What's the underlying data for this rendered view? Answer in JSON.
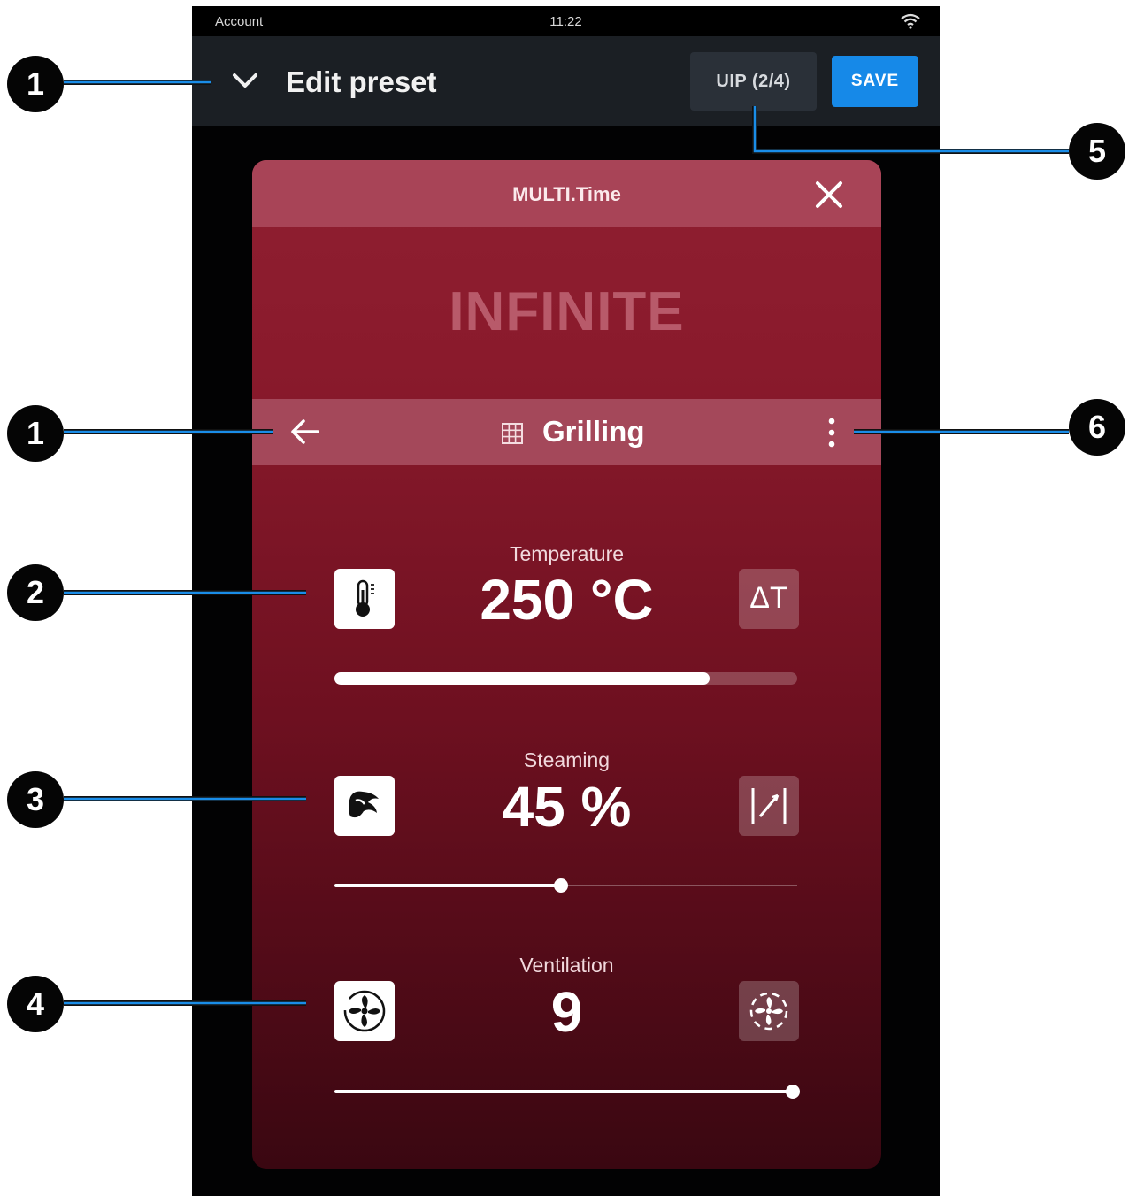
{
  "status_bar": {
    "account": "Account",
    "time": "11:22",
    "wifi_icon": "wifi-icon"
  },
  "top_bar": {
    "collapse_icon": "chevron-down-icon",
    "title": "Edit preset",
    "uip_button": "UIP (2/4)",
    "save_button": "SAVE"
  },
  "card": {
    "header_title": "MULTI.Time",
    "close_icon": "close-icon",
    "duration": "INFINITE",
    "mode_bar": {
      "back_icon": "arrow-left-icon",
      "mode_icon": "grid-icon",
      "mode_name": "Grilling",
      "menu_icon": "more-vertical-icon"
    },
    "parameters": [
      {
        "label": "Temperature",
        "value": "250 °C",
        "left_icon": "thermometer-icon",
        "right_icon": "delta-t-icon",
        "right_icon_text": "ΔT",
        "slider_fraction": 0.81
      },
      {
        "label": "Steaming",
        "value": "45 %",
        "left_icon": "steam-icon",
        "right_icon": "valve-icon",
        "slider_fraction": 0.49
      },
      {
        "label": "Ventilation",
        "value": "9",
        "left_icon": "fan-icon",
        "right_icon": "fan-pulse-icon",
        "slider_fraction": 0.99
      }
    ]
  },
  "callouts": [
    "1",
    "1",
    "2",
    "3",
    "4",
    "5",
    "6"
  ],
  "colors": {
    "save_blue": "#1689e8",
    "callout_line": "#1a8de8",
    "card_red": "#8f1f31",
    "header_pink": "#a84457"
  }
}
